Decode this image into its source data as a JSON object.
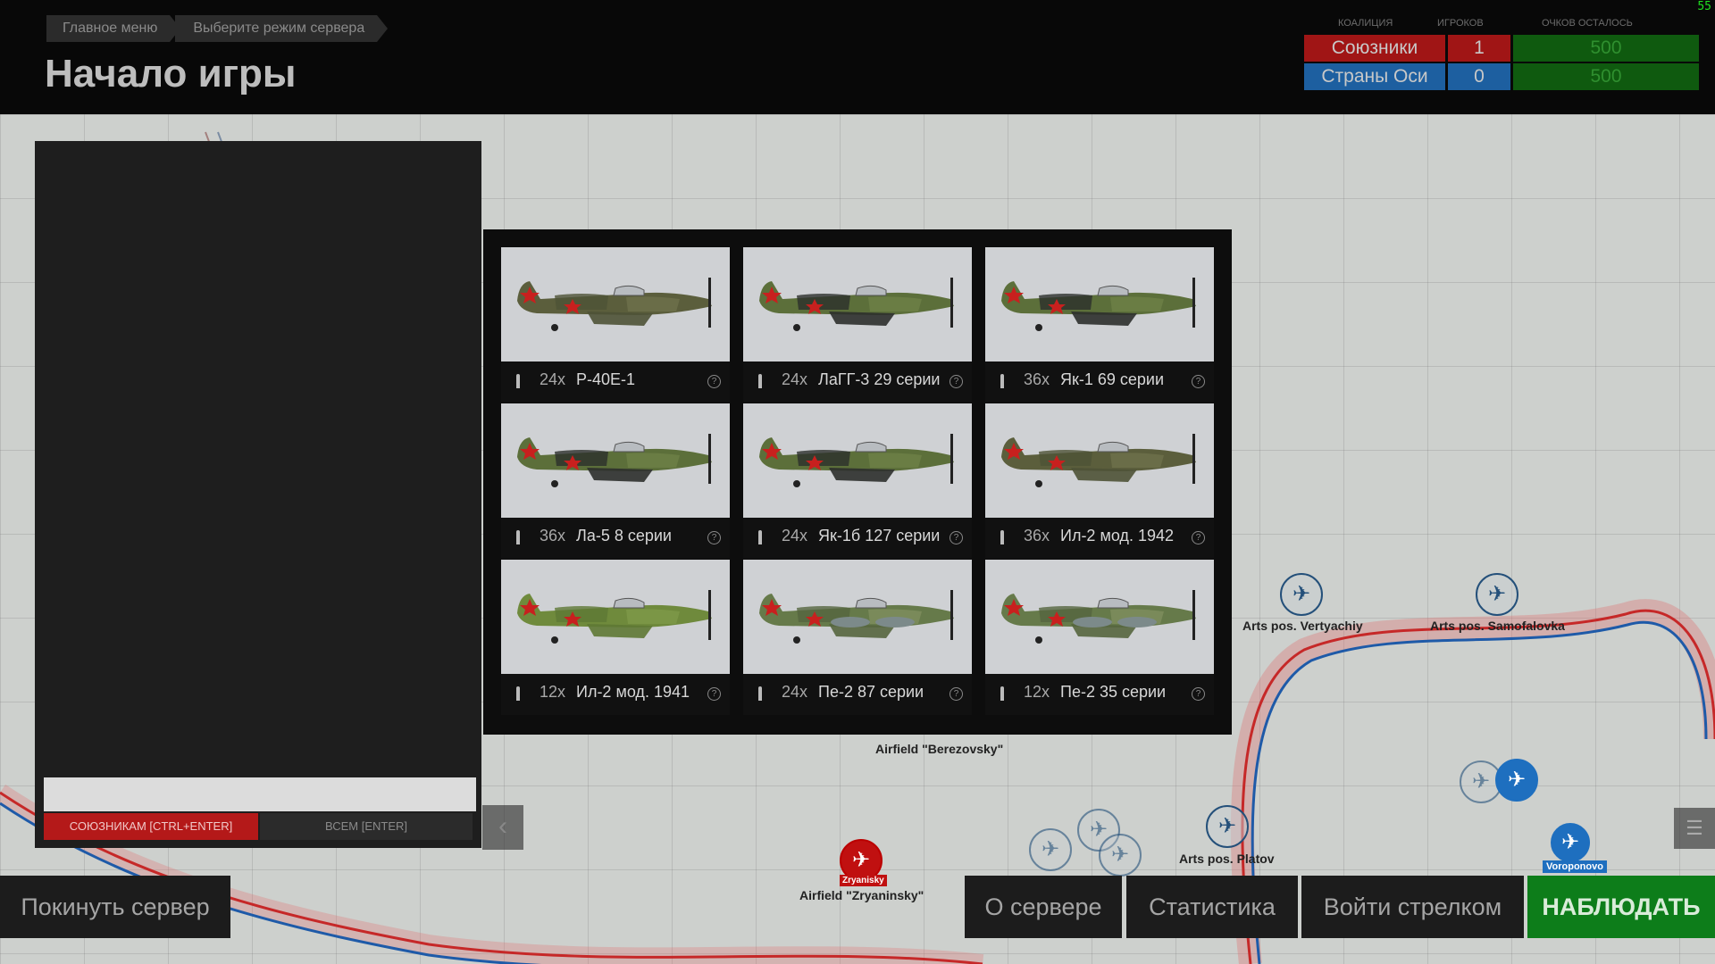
{
  "breadcrumb": [
    "Главное меню",
    "Выберите режим сервера"
  ],
  "page_title": "Начало игры",
  "fps": "55",
  "scoreboard": {
    "headers": {
      "coalition": "КОАЛИЦИЯ",
      "players": "ИГРОКОВ",
      "points_left": "ОЧКОВ ОСТАЛОСЬ"
    },
    "rows": [
      {
        "name": "Союзники",
        "players": "1",
        "points": "500",
        "color": "#a01515"
      },
      {
        "name": "Страны Оси",
        "players": "0",
        "points": "500",
        "color": "#1d5fa0"
      }
    ]
  },
  "chat": {
    "allies_button": "СОЮЗНИКАМ [CTRL+ENTER]",
    "all_button": "ВСЕМ [ENTER]",
    "input_value": ""
  },
  "aircraft": [
    {
      "count": "24x",
      "name": "P-40E-1",
      "camo": "olive",
      "icon": "bullet-icon"
    },
    {
      "count": "24x",
      "name": "ЛаГГ-3 29 серии",
      "camo": "camo",
      "icon": "bullet-icon"
    },
    {
      "count": "36x",
      "name": "Як-1 69 серии",
      "camo": "camo",
      "icon": "bullet-icon"
    },
    {
      "count": "36x",
      "name": "Ла-5 8 серии",
      "camo": "camo",
      "icon": "bullet-icon"
    },
    {
      "count": "24x",
      "name": "Як-1б 127 серии",
      "camo": "camo",
      "icon": "bullet-icon"
    },
    {
      "count": "36x",
      "name": "Ил-2 мод. 1942",
      "camo": "olive",
      "icon": "bomb-icon"
    },
    {
      "count": "12x",
      "name": "Ил-2 мод. 1941",
      "camo": "green",
      "icon": "bomb-icon"
    },
    {
      "count": "24x",
      "name": "Пе-2 87 серии",
      "camo": "twin",
      "icon": "bomb-icon"
    },
    {
      "count": "12x",
      "name": "Пе-2 35 серии",
      "camo": "twin",
      "icon": "bomb-icon"
    }
  ],
  "map": {
    "labels": {
      "vertyachiy": "Arts pos. Vertyachiy",
      "samofalovka": "Arts pos. Samofalovka",
      "berezovsky": "Airfield \"Berezovsky\"",
      "platov": "Arts pos. Platov",
      "zryaninsky": "Airfield \"Zryaninsky\"",
      "zryaninsky_tag": "Zryanisky",
      "voroponovo": "Voroponovo",
      "airfield_small": "Airfield"
    }
  },
  "bottom_buttons": {
    "leave": "Покинуть сервер",
    "about": "О сервере",
    "stats": "Статистика",
    "gunner": "Войти стрелком",
    "spectate": "НАБЛЮДАТЬ"
  },
  "colors": {
    "allies": "#b41919",
    "axis": "#1d5fa0",
    "spectate": "#0d7d1a",
    "front_red": "#c62828",
    "front_blue": "#1e5aa8"
  }
}
